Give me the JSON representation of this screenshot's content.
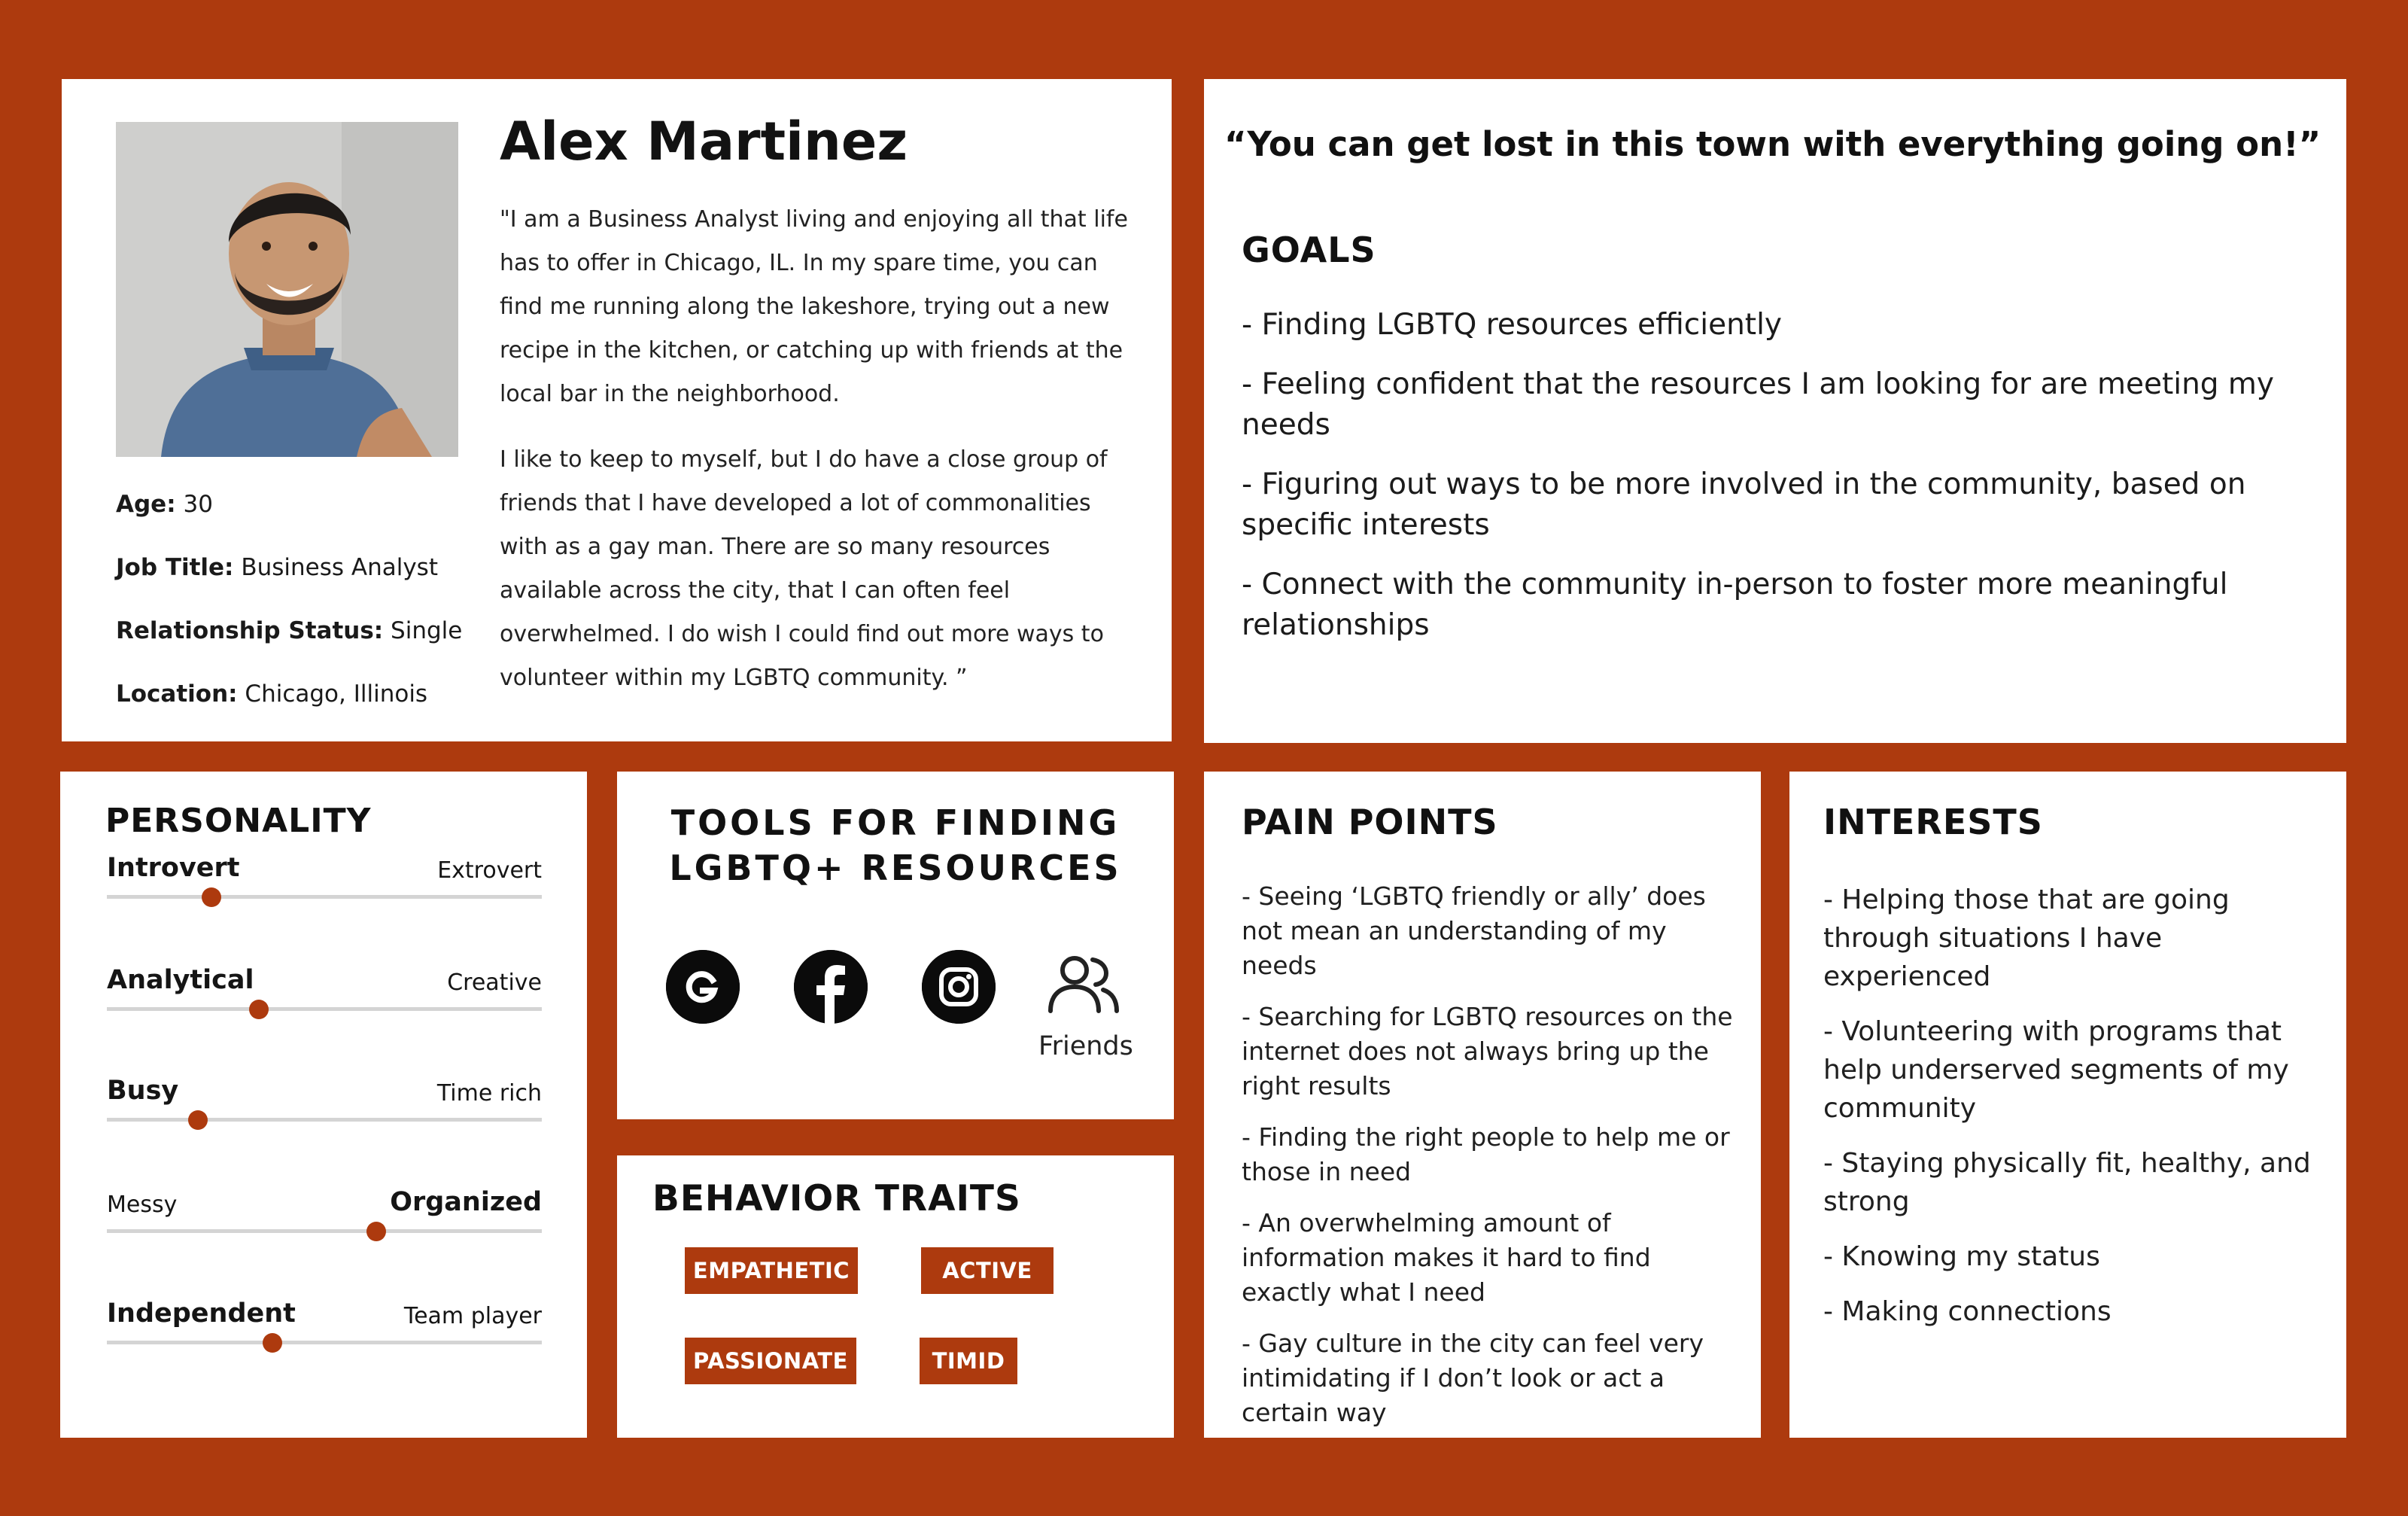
{
  "colors": {
    "accent": "#AD3A0E",
    "card": "#FFFFFF",
    "text": "#161616"
  },
  "profile": {
    "name": "Alex Martinez",
    "bio": [
      "\"I am a Business Analyst living and enjoying all that life has to offer in Chicago, IL. In my spare time, you can find me running along the lakeshore, trying out a new recipe in the kitchen, or catching up with friends at the local bar in the neighborhood.",
      "I like to keep to myself, but I do have a close group of friends that I have developed a lot of commonalities with as a gay man. There are so many resources available across the city, that I can often feel overwhelmed. I do wish I could find out more ways to volunteer within my LGBTQ community. ”"
    ],
    "facts": [
      {
        "label": "Age:",
        "value": "30"
      },
      {
        "label": "Job Title:",
        "value": "Business Analyst"
      },
      {
        "label": "Relationship Status:",
        "value": "Single"
      },
      {
        "label": "Location:",
        "value": "Chicago, Illinois"
      }
    ]
  },
  "quote": "“You can get lost in this town with everything going on!”",
  "goals": {
    "title": "GOALS",
    "items": [
      "- Finding LGBTQ resources efficiently",
      "- Feeling confident that the resources I am looking for are meeting my needs",
      "- Figuring out ways to be more involved in the community, based on specific interests",
      "- Connect with the community in-person to foster more meaningful relationships"
    ]
  },
  "personality": {
    "title": "PERSONALITY",
    "sliders": [
      {
        "left": "Introvert",
        "right": "Extrovert",
        "emphasis": "left",
        "position": 0.24
      },
      {
        "left": "Analytical",
        "right": "Creative",
        "emphasis": "left",
        "position": 0.35
      },
      {
        "left": "Busy",
        "right": "Time rich",
        "emphasis": "left",
        "position": 0.21
      },
      {
        "left": "Messy",
        "right": "Organized",
        "emphasis": "right",
        "position": 0.62
      },
      {
        "left": "Independent",
        "right": "Team player",
        "emphasis": "left",
        "position": 0.38
      }
    ]
  },
  "tools": {
    "title_line1": "TOOLS FOR FINDING",
    "title_line2": "LGBTQ+ RESOURCES",
    "icons": [
      "google-icon",
      "facebook-icon",
      "instagram-icon",
      "friends-icon"
    ],
    "friends_label": "Friends"
  },
  "behavior": {
    "title": "BEHAVIOR TRAITS",
    "traits": [
      "EMPATHETIC",
      "ACTIVE",
      "PASSIONATE",
      "TIMID"
    ]
  },
  "pain_points": {
    "title": "PAIN POINTS",
    "items": [
      "- Seeing ‘LGBTQ friendly or ally’ does not mean an understanding of my needs",
      "- Searching for LGBTQ resources on the internet does not always bring up the right results",
      "- Finding the right people to help me or those in need",
      "- An overwhelming amount of information makes it hard to find exactly what I need",
      "- Gay culture in the city can feel very intimidating if I don’t look or act a certain way"
    ]
  },
  "interests": {
    "title": "INTERESTS",
    "items": [
      "- Helping those that are going through situations I have experienced",
      "- Volunteering with programs that help underserved segments of my community",
      "- Staying physically fit, healthy, and strong",
      "- Knowing my status",
      "- Making connections"
    ]
  }
}
